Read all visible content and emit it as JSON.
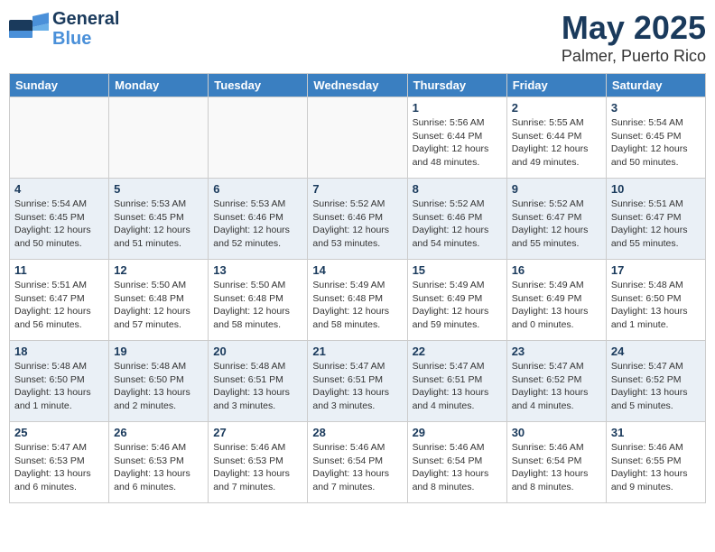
{
  "header": {
    "logo_general": "General",
    "logo_blue": "Blue",
    "month": "May 2025",
    "location": "Palmer, Puerto Rico"
  },
  "days_of_week": [
    "Sunday",
    "Monday",
    "Tuesday",
    "Wednesday",
    "Thursday",
    "Friday",
    "Saturday"
  ],
  "weeks": [
    [
      {
        "day": "",
        "sunrise": "",
        "sunset": "",
        "daylight": ""
      },
      {
        "day": "",
        "sunrise": "",
        "sunset": "",
        "daylight": ""
      },
      {
        "day": "",
        "sunrise": "",
        "sunset": "",
        "daylight": ""
      },
      {
        "day": "",
        "sunrise": "",
        "sunset": "",
        "daylight": ""
      },
      {
        "day": "1",
        "sunrise": "Sunrise: 5:56 AM",
        "sunset": "Sunset: 6:44 PM",
        "daylight": "Daylight: 12 hours and 48 minutes."
      },
      {
        "day": "2",
        "sunrise": "Sunrise: 5:55 AM",
        "sunset": "Sunset: 6:44 PM",
        "daylight": "Daylight: 12 hours and 49 minutes."
      },
      {
        "day": "3",
        "sunrise": "Sunrise: 5:54 AM",
        "sunset": "Sunset: 6:45 PM",
        "daylight": "Daylight: 12 hours and 50 minutes."
      }
    ],
    [
      {
        "day": "4",
        "sunrise": "Sunrise: 5:54 AM",
        "sunset": "Sunset: 6:45 PM",
        "daylight": "Daylight: 12 hours and 50 minutes."
      },
      {
        "day": "5",
        "sunrise": "Sunrise: 5:53 AM",
        "sunset": "Sunset: 6:45 PM",
        "daylight": "Daylight: 12 hours and 51 minutes."
      },
      {
        "day": "6",
        "sunrise": "Sunrise: 5:53 AM",
        "sunset": "Sunset: 6:46 PM",
        "daylight": "Daylight: 12 hours and 52 minutes."
      },
      {
        "day": "7",
        "sunrise": "Sunrise: 5:52 AM",
        "sunset": "Sunset: 6:46 PM",
        "daylight": "Daylight: 12 hours and 53 minutes."
      },
      {
        "day": "8",
        "sunrise": "Sunrise: 5:52 AM",
        "sunset": "Sunset: 6:46 PM",
        "daylight": "Daylight: 12 hours and 54 minutes."
      },
      {
        "day": "9",
        "sunrise": "Sunrise: 5:52 AM",
        "sunset": "Sunset: 6:47 PM",
        "daylight": "Daylight: 12 hours and 55 minutes."
      },
      {
        "day": "10",
        "sunrise": "Sunrise: 5:51 AM",
        "sunset": "Sunset: 6:47 PM",
        "daylight": "Daylight: 12 hours and 55 minutes."
      }
    ],
    [
      {
        "day": "11",
        "sunrise": "Sunrise: 5:51 AM",
        "sunset": "Sunset: 6:47 PM",
        "daylight": "Daylight: 12 hours and 56 minutes."
      },
      {
        "day": "12",
        "sunrise": "Sunrise: 5:50 AM",
        "sunset": "Sunset: 6:48 PM",
        "daylight": "Daylight: 12 hours and 57 minutes."
      },
      {
        "day": "13",
        "sunrise": "Sunrise: 5:50 AM",
        "sunset": "Sunset: 6:48 PM",
        "daylight": "Daylight: 12 hours and 58 minutes."
      },
      {
        "day": "14",
        "sunrise": "Sunrise: 5:49 AM",
        "sunset": "Sunset: 6:48 PM",
        "daylight": "Daylight: 12 hours and 58 minutes."
      },
      {
        "day": "15",
        "sunrise": "Sunrise: 5:49 AM",
        "sunset": "Sunset: 6:49 PM",
        "daylight": "Daylight: 12 hours and 59 minutes."
      },
      {
        "day": "16",
        "sunrise": "Sunrise: 5:49 AM",
        "sunset": "Sunset: 6:49 PM",
        "daylight": "Daylight: 13 hours and 0 minutes."
      },
      {
        "day": "17",
        "sunrise": "Sunrise: 5:48 AM",
        "sunset": "Sunset: 6:50 PM",
        "daylight": "Daylight: 13 hours and 1 minute."
      }
    ],
    [
      {
        "day": "18",
        "sunrise": "Sunrise: 5:48 AM",
        "sunset": "Sunset: 6:50 PM",
        "daylight": "Daylight: 13 hours and 1 minute."
      },
      {
        "day": "19",
        "sunrise": "Sunrise: 5:48 AM",
        "sunset": "Sunset: 6:50 PM",
        "daylight": "Daylight: 13 hours and 2 minutes."
      },
      {
        "day": "20",
        "sunrise": "Sunrise: 5:48 AM",
        "sunset": "Sunset: 6:51 PM",
        "daylight": "Daylight: 13 hours and 3 minutes."
      },
      {
        "day": "21",
        "sunrise": "Sunrise: 5:47 AM",
        "sunset": "Sunset: 6:51 PM",
        "daylight": "Daylight: 13 hours and 3 minutes."
      },
      {
        "day": "22",
        "sunrise": "Sunrise: 5:47 AM",
        "sunset": "Sunset: 6:51 PM",
        "daylight": "Daylight: 13 hours and 4 minutes."
      },
      {
        "day": "23",
        "sunrise": "Sunrise: 5:47 AM",
        "sunset": "Sunset: 6:52 PM",
        "daylight": "Daylight: 13 hours and 4 minutes."
      },
      {
        "day": "24",
        "sunrise": "Sunrise: 5:47 AM",
        "sunset": "Sunset: 6:52 PM",
        "daylight": "Daylight: 13 hours and 5 minutes."
      }
    ],
    [
      {
        "day": "25",
        "sunrise": "Sunrise: 5:47 AM",
        "sunset": "Sunset: 6:53 PM",
        "daylight": "Daylight: 13 hours and 6 minutes."
      },
      {
        "day": "26",
        "sunrise": "Sunrise: 5:46 AM",
        "sunset": "Sunset: 6:53 PM",
        "daylight": "Daylight: 13 hours and 6 minutes."
      },
      {
        "day": "27",
        "sunrise": "Sunrise: 5:46 AM",
        "sunset": "Sunset: 6:53 PM",
        "daylight": "Daylight: 13 hours and 7 minutes."
      },
      {
        "day": "28",
        "sunrise": "Sunrise: 5:46 AM",
        "sunset": "Sunset: 6:54 PM",
        "daylight": "Daylight: 13 hours and 7 minutes."
      },
      {
        "day": "29",
        "sunrise": "Sunrise: 5:46 AM",
        "sunset": "Sunset: 6:54 PM",
        "daylight": "Daylight: 13 hours and 8 minutes."
      },
      {
        "day": "30",
        "sunrise": "Sunrise: 5:46 AM",
        "sunset": "Sunset: 6:54 PM",
        "daylight": "Daylight: 13 hours and 8 minutes."
      },
      {
        "day": "31",
        "sunrise": "Sunrise: 5:46 AM",
        "sunset": "Sunset: 6:55 PM",
        "daylight": "Daylight: 13 hours and 9 minutes."
      }
    ]
  ]
}
